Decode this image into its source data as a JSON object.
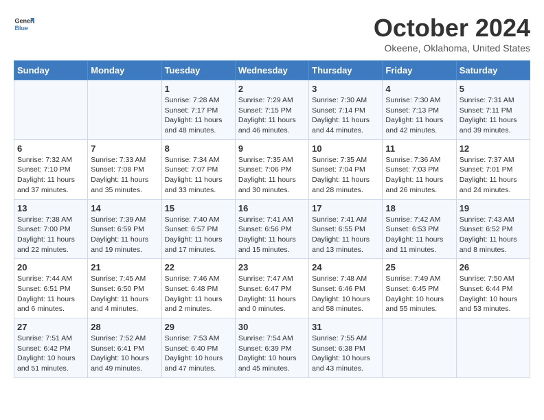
{
  "header": {
    "logo_line1": "General",
    "logo_line2": "Blue",
    "month": "October 2024",
    "location": "Okeene, Oklahoma, United States"
  },
  "days_of_week": [
    "Sunday",
    "Monday",
    "Tuesday",
    "Wednesday",
    "Thursday",
    "Friday",
    "Saturday"
  ],
  "weeks": [
    [
      {
        "day": "",
        "info": ""
      },
      {
        "day": "",
        "info": ""
      },
      {
        "day": "1",
        "info": "Sunrise: 7:28 AM\nSunset: 7:17 PM\nDaylight: 11 hours and 48 minutes."
      },
      {
        "day": "2",
        "info": "Sunrise: 7:29 AM\nSunset: 7:15 PM\nDaylight: 11 hours and 46 minutes."
      },
      {
        "day": "3",
        "info": "Sunrise: 7:30 AM\nSunset: 7:14 PM\nDaylight: 11 hours and 44 minutes."
      },
      {
        "day": "4",
        "info": "Sunrise: 7:30 AM\nSunset: 7:13 PM\nDaylight: 11 hours and 42 minutes."
      },
      {
        "day": "5",
        "info": "Sunrise: 7:31 AM\nSunset: 7:11 PM\nDaylight: 11 hours and 39 minutes."
      }
    ],
    [
      {
        "day": "6",
        "info": "Sunrise: 7:32 AM\nSunset: 7:10 PM\nDaylight: 11 hours and 37 minutes."
      },
      {
        "day": "7",
        "info": "Sunrise: 7:33 AM\nSunset: 7:08 PM\nDaylight: 11 hours and 35 minutes."
      },
      {
        "day": "8",
        "info": "Sunrise: 7:34 AM\nSunset: 7:07 PM\nDaylight: 11 hours and 33 minutes."
      },
      {
        "day": "9",
        "info": "Sunrise: 7:35 AM\nSunset: 7:06 PM\nDaylight: 11 hours and 30 minutes."
      },
      {
        "day": "10",
        "info": "Sunrise: 7:35 AM\nSunset: 7:04 PM\nDaylight: 11 hours and 28 minutes."
      },
      {
        "day": "11",
        "info": "Sunrise: 7:36 AM\nSunset: 7:03 PM\nDaylight: 11 hours and 26 minutes."
      },
      {
        "day": "12",
        "info": "Sunrise: 7:37 AM\nSunset: 7:01 PM\nDaylight: 11 hours and 24 minutes."
      }
    ],
    [
      {
        "day": "13",
        "info": "Sunrise: 7:38 AM\nSunset: 7:00 PM\nDaylight: 11 hours and 22 minutes."
      },
      {
        "day": "14",
        "info": "Sunrise: 7:39 AM\nSunset: 6:59 PM\nDaylight: 11 hours and 19 minutes."
      },
      {
        "day": "15",
        "info": "Sunrise: 7:40 AM\nSunset: 6:57 PM\nDaylight: 11 hours and 17 minutes."
      },
      {
        "day": "16",
        "info": "Sunrise: 7:41 AM\nSunset: 6:56 PM\nDaylight: 11 hours and 15 minutes."
      },
      {
        "day": "17",
        "info": "Sunrise: 7:41 AM\nSunset: 6:55 PM\nDaylight: 11 hours and 13 minutes."
      },
      {
        "day": "18",
        "info": "Sunrise: 7:42 AM\nSunset: 6:53 PM\nDaylight: 11 hours and 11 minutes."
      },
      {
        "day": "19",
        "info": "Sunrise: 7:43 AM\nSunset: 6:52 PM\nDaylight: 11 hours and 8 minutes."
      }
    ],
    [
      {
        "day": "20",
        "info": "Sunrise: 7:44 AM\nSunset: 6:51 PM\nDaylight: 11 hours and 6 minutes."
      },
      {
        "day": "21",
        "info": "Sunrise: 7:45 AM\nSunset: 6:50 PM\nDaylight: 11 hours and 4 minutes."
      },
      {
        "day": "22",
        "info": "Sunrise: 7:46 AM\nSunset: 6:48 PM\nDaylight: 11 hours and 2 minutes."
      },
      {
        "day": "23",
        "info": "Sunrise: 7:47 AM\nSunset: 6:47 PM\nDaylight: 11 hours and 0 minutes."
      },
      {
        "day": "24",
        "info": "Sunrise: 7:48 AM\nSunset: 6:46 PM\nDaylight: 10 hours and 58 minutes."
      },
      {
        "day": "25",
        "info": "Sunrise: 7:49 AM\nSunset: 6:45 PM\nDaylight: 10 hours and 55 minutes."
      },
      {
        "day": "26",
        "info": "Sunrise: 7:50 AM\nSunset: 6:44 PM\nDaylight: 10 hours and 53 minutes."
      }
    ],
    [
      {
        "day": "27",
        "info": "Sunrise: 7:51 AM\nSunset: 6:42 PM\nDaylight: 10 hours and 51 minutes."
      },
      {
        "day": "28",
        "info": "Sunrise: 7:52 AM\nSunset: 6:41 PM\nDaylight: 10 hours and 49 minutes."
      },
      {
        "day": "29",
        "info": "Sunrise: 7:53 AM\nSunset: 6:40 PM\nDaylight: 10 hours and 47 minutes."
      },
      {
        "day": "30",
        "info": "Sunrise: 7:54 AM\nSunset: 6:39 PM\nDaylight: 10 hours and 45 minutes."
      },
      {
        "day": "31",
        "info": "Sunrise: 7:55 AM\nSunset: 6:38 PM\nDaylight: 10 hours and 43 minutes."
      },
      {
        "day": "",
        "info": ""
      },
      {
        "day": "",
        "info": ""
      }
    ]
  ]
}
